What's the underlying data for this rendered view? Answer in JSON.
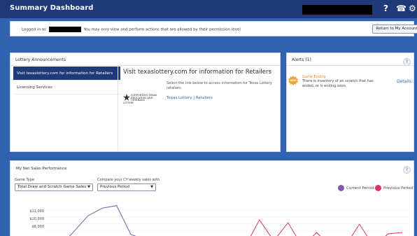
{
  "header": {
    "title": "Summary Dashboard",
    "help_icon": "?",
    "phone_icon": "☎",
    "gear_icon": "⚙"
  },
  "login": {
    "prefix": "Logged in as",
    "suffix": "You may only view and perform actions that are allowed by their permission level",
    "button": "Return to My Account"
  },
  "lottery": {
    "title": "Lottery Announcements",
    "nav": [
      {
        "label": "Visit texaslottery.com for information for Retailers",
        "active": true
      },
      {
        "label": "Licensing Services",
        "active": false
      }
    ],
    "content_title": "Visit texaslottery.com for information for Retailers",
    "content_desc": "Select the link below to access information for Texas Lottery retailers.",
    "logo_text": "SUPPORTING TEXAS EDUCATION AND VETERANS",
    "logo_brand": "LOTTERY",
    "link": "Texas Lottery | Retailers"
  },
  "alerts": {
    "title": "Alerts (1)",
    "help": "?",
    "badge": "NEW",
    "item_title": "Game Ending",
    "item_desc": "There is inventory of an scratch that has ended, or is ending soon.",
    "details": "Details..."
  },
  "sales": {
    "title": "My Net Sales Performance",
    "help": "?",
    "game_type_label": "Game Type",
    "game_type_value": "Total Draw and Scratch Game Sales",
    "compare_label": "Compare your CY weekly sales with",
    "compare_value": "Previous Period",
    "legend_current": "Current Period",
    "legend_previous": "Previous Period",
    "colors": {
      "current": "#7b5bb5",
      "previous": "#d6336c"
    }
  },
  "chart_data": {
    "type": "line",
    "y_ticks": [
      "$12,000",
      "$10,000",
      "$8,000"
    ],
    "series": [
      {
        "name": "Current Period",
        "values": [
          0,
          4800,
          10500,
          13200,
          14100,
          3800,
          2000,
          0,
          800,
          0,
          0,
          0,
          0,
          0,
          0,
          0,
          0,
          0,
          0,
          0,
          0,
          0,
          0,
          0,
          0
        ]
      },
      {
        "name": "Previous Period",
        "values": [
          0,
          0,
          0,
          0,
          0,
          0,
          0,
          0,
          0,
          0,
          0,
          0,
          0,
          0,
          9000,
          1500,
          8000,
          0,
          4500,
          0,
          0,
          7500,
          0,
          4000,
          4500
        ]
      }
    ],
    "ylim": [
      2000,
      15000
    ]
  }
}
